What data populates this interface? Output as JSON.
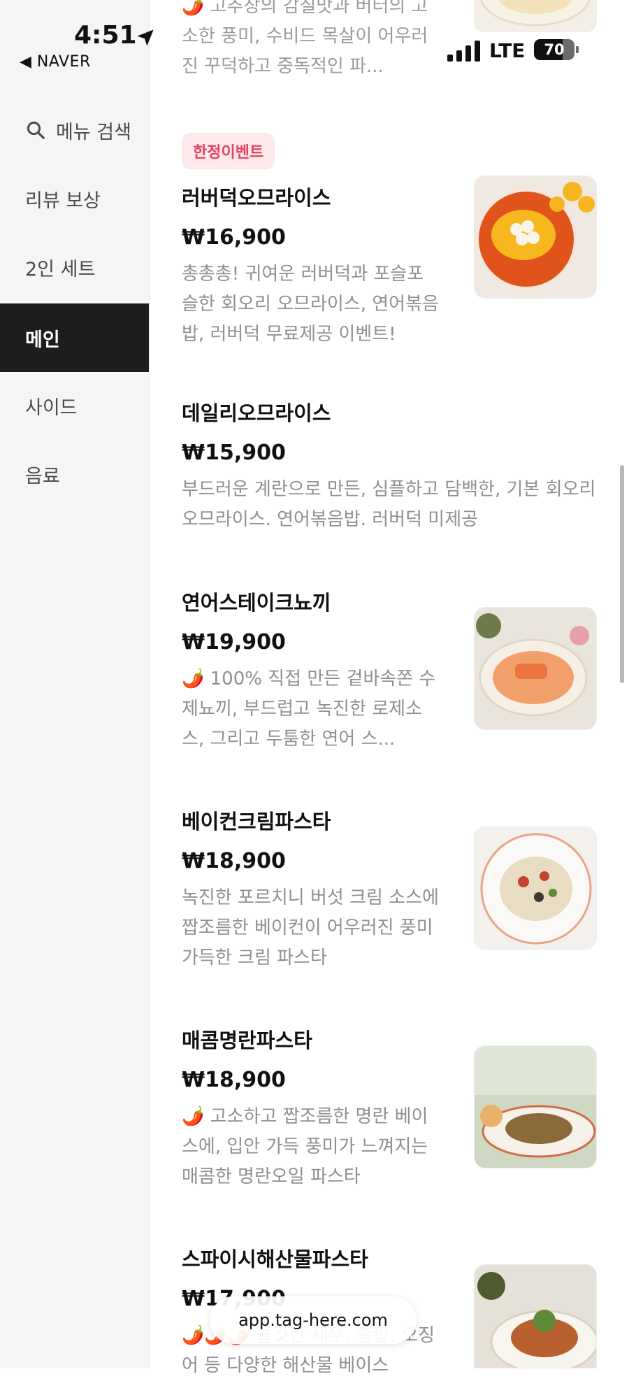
{
  "status_bar": {
    "time": "4:51",
    "back_label": "NAVER",
    "network": "LTE",
    "battery": "70"
  },
  "sidebar": {
    "items": [
      {
        "label": "메뉴 검색"
      },
      {
        "label": "리뷰 보상"
      },
      {
        "label": "2인 세트"
      },
      {
        "label": "메인"
      },
      {
        "label": "사이드"
      },
      {
        "label": "음료"
      }
    ]
  },
  "top_partial": {
    "desc": "🌶️ 고추장의 감칠맛과 버터의 고소한 풍미, 수비드 목살이 어우러진 꾸덕하고 중독적인 파..."
  },
  "menu_items": [
    {
      "badge": "한정이벤트",
      "name": "러버덕오므라이스",
      "price": "₩16,900",
      "desc": "총총총! 귀여운 러버덕과 포슬포슬한 회오리 오므라이스, 연어볶음밥, 러버덕 무료제공 이벤트!"
    },
    {
      "name": "데일리오므라이스",
      "price": "₩15,900",
      "desc": "부드러운 계란으로 만든, 심플하고 담백한, 기본 회오리 오므라이스. 연어볶음밥. 러버덕 미제공"
    },
    {
      "name": "연어스테이크뇨끼",
      "price": "₩19,900",
      "desc": "🌶️ 100% 직접 만든 겉바속쫀 수제뇨끼, 부드럽고 녹진한 로제소스, 그리고 두툼한 연어 스..."
    },
    {
      "name": "베이컨크림파스타",
      "price": "₩18,900",
      "desc": "녹진한 포르치니 버섯 크림 소스에 짭조름한 베이컨이 어우러진 풍미 가득한 크림 파스타"
    },
    {
      "name": "매콤명란파스타",
      "price": "₩18,900",
      "desc": "🌶️ 고소하고 짭조름한 명란 베이스에, 입안 가득 풍미가 느껴지는 매콤한 명란오일 파스타"
    },
    {
      "name": "스파이시해산물파스타",
      "price": "₩17,900",
      "desc": "🌶️🌶️🌶️ 쫄깃한 새우, 홍합, 오징어 등 다양한 해산물 베이스"
    }
  ],
  "url_bar": {
    "url": "app.tag-here.com"
  }
}
